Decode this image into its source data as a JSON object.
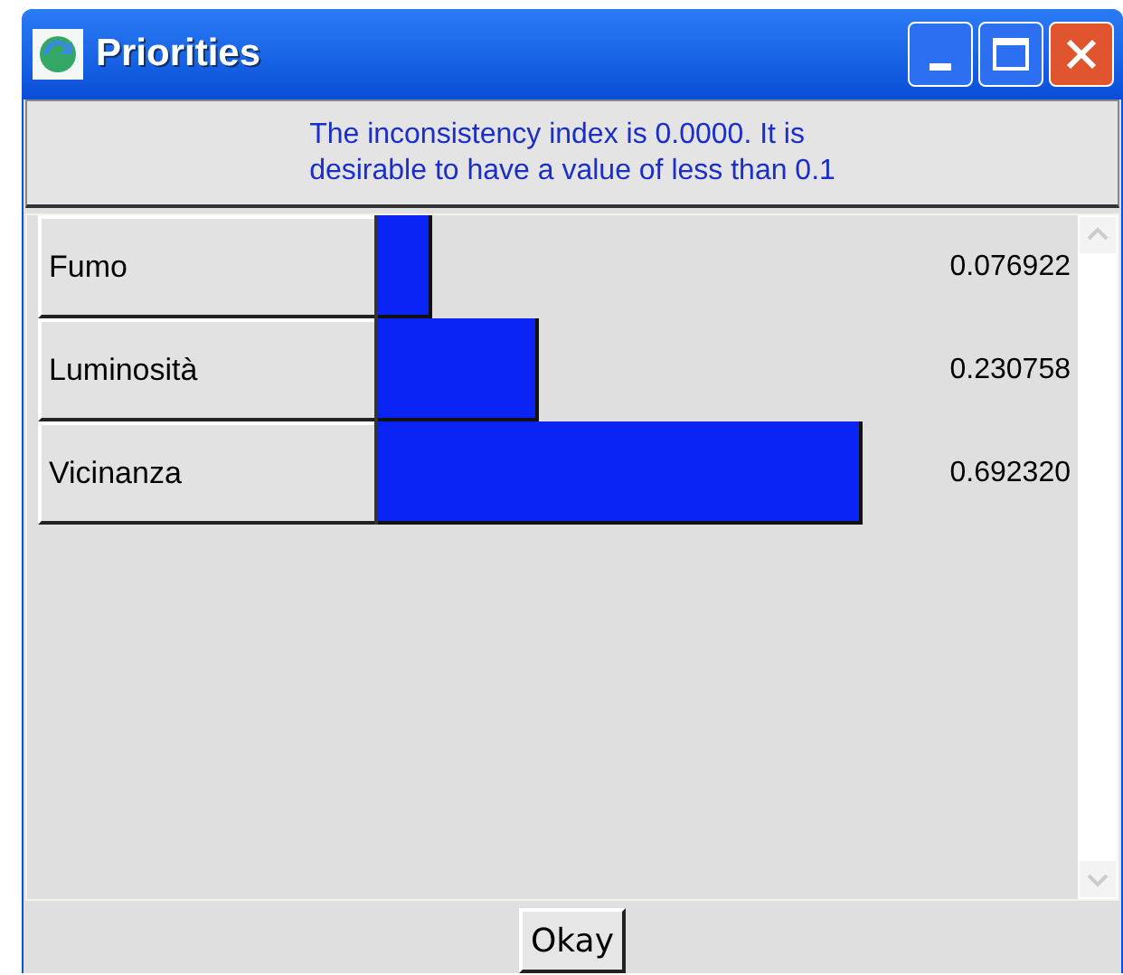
{
  "window": {
    "title": "Priorities"
  },
  "message": "The inconsistency index is 0.0000.  It is\ndesirable to have a value of less than 0.1",
  "priorities": [
    {
      "name": "Fumo",
      "value": "0.076922",
      "level": 0.076922
    },
    {
      "name": "Luminosità",
      "value": "0.230758",
      "level": 0.230758
    },
    {
      "name": "Vicinanza",
      "value": "0.692320",
      "level": 0.69232
    }
  ],
  "buttons": [
    "Okay"
  ]
}
